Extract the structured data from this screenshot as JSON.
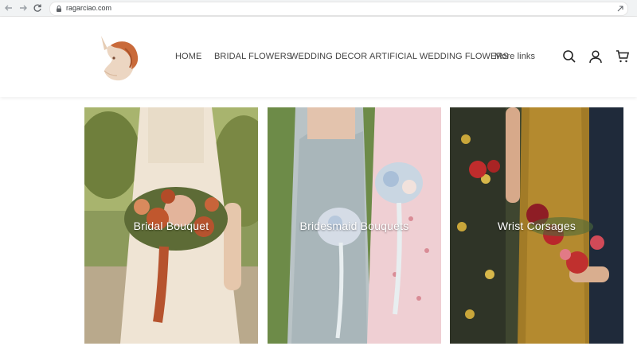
{
  "browser": {
    "url": "ragarciao.com"
  },
  "header": {
    "logo_name": "unicorn-logo",
    "nav": [
      {
        "label": "HOME"
      },
      {
        "label": "BRIDAL FLOWERS"
      },
      {
        "label": "WEDDING DECOR"
      },
      {
        "label": "ARTIFICIAL WEDDING FLOWERS"
      },
      {
        "label": "More links"
      }
    ],
    "icons": [
      "search-icon",
      "account-icon",
      "cart-icon"
    ]
  },
  "collections": [
    {
      "label": "Bridal Bouquet"
    },
    {
      "label": "Bridesmaid Bouquets"
    },
    {
      "label": "Wrist Corsages"
    }
  ],
  "colors": {
    "nav_text": "#444444",
    "browser_bar": "#f1f3f4",
    "logo_mane": "#c96a3a"
  }
}
